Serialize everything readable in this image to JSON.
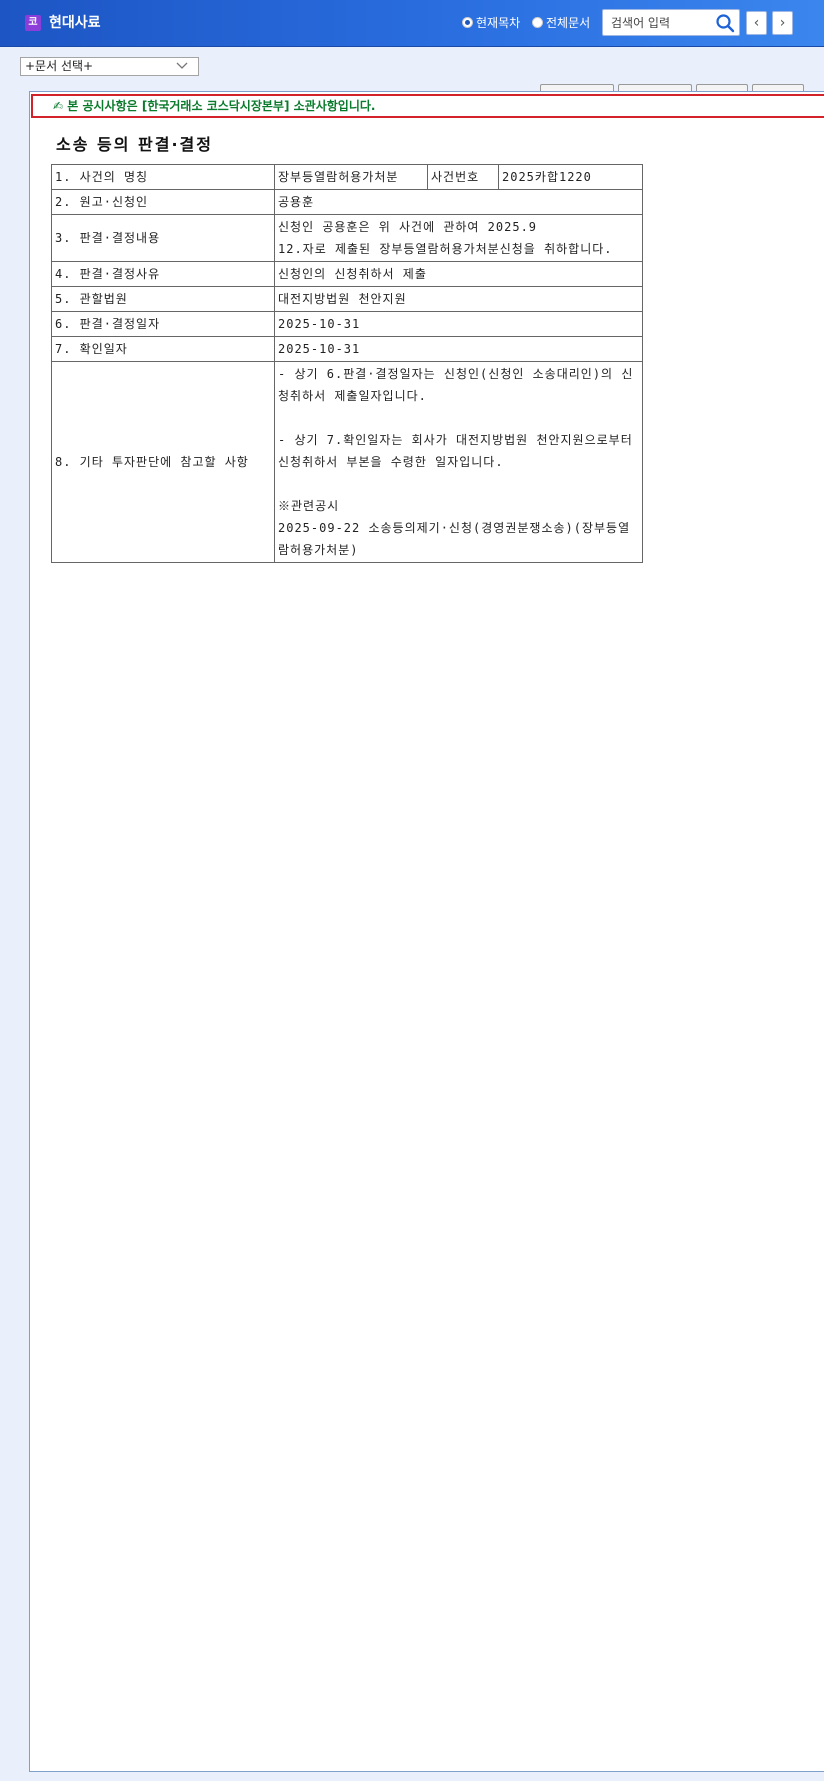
{
  "header": {
    "logo_char": "코",
    "company_name": "현대사료",
    "radio_current": "현재목차",
    "radio_all": "전체문서",
    "search_placeholder": "검색어 입력",
    "prev_symbol": "‹",
    "next_symbol": "›"
  },
  "document_select": {
    "selected": "+문서 선택+"
  },
  "notice": {
    "text": "✍ 본 공시사항은 [한국거래소 코스닥시장본부] 소관사항입니다."
  },
  "document": {
    "title": "소송 등의 판결·결정",
    "rows": [
      {
        "label": "1. 사건의 명칭",
        "value": "장부등열람허용가처분",
        "extra_label": "사건번호",
        "extra_value": "2025카합1220"
      },
      {
        "label": "2. 원고·신청인",
        "value": "공용훈"
      },
      {
        "label": "3. 판결·결정내용",
        "value": "신청인 공용훈은 위 사건에 관하여 2025.9\n12.자로 제출된 장부등열람허용가처분신청을 취하합니다."
      },
      {
        "label": "4. 판결·결정사유",
        "value": "신청인의 신청취하서 제출"
      },
      {
        "label": "5. 관할법원",
        "value": "대전지방법원 천안지원"
      },
      {
        "label": "6. 판결·결정일자",
        "value": "2025-10-31"
      },
      {
        "label": "7. 확인일자",
        "value": "2025-10-31"
      },
      {
        "label": "8. 기타 투자판단에 참고할 사항",
        "value": "- 상기 6.판결·결정일자는 신청인(신청인 소송대리인)의 신청취하서 제출일자입니다.\n\n- 상기 7.확인일자는 회사가 대전지방법원 천안지원으로부터 신청취하서 부본을 수령한 일자입니다.\n\n※관련공시\n2025-09-22 소송등의제기·신청(경영권분쟁소송)(장부등열람허용가처분)"
      }
    ]
  },
  "colors": {
    "header_start": "#1d55c4",
    "header_end": "#3b86ee",
    "notice_border": "#d2232a",
    "notice_text": "#0a7a2c",
    "page_bg": "#e9f0fb"
  }
}
